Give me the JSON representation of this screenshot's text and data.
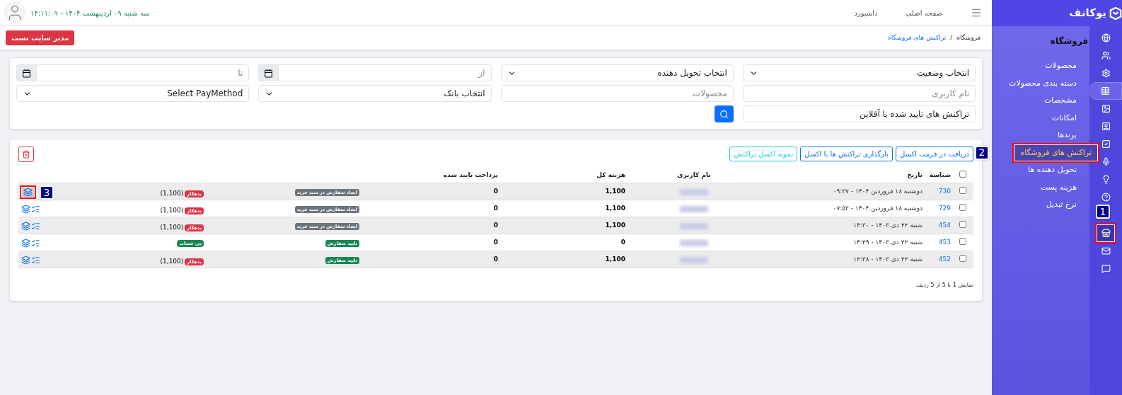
{
  "sidebar": {
    "logo": "یوکانف",
    "icons": [
      {
        "selected": false
      },
      {
        "selected": false
      },
      {
        "selected": false
      },
      {
        "selected": true
      },
      {
        "selected": false
      },
      {
        "selected": false
      },
      {
        "selected": false
      },
      {
        "selected": false
      },
      {
        "selected": false
      },
      {
        "selected": false
      },
      {
        "selected": false,
        "callout": "1"
      },
      {
        "selected": false
      },
      {
        "selected": false
      }
    ],
    "section": "فروشگاه",
    "items": [
      {
        "label": "محصولات",
        "selected": false
      },
      {
        "label": "دسته بندی محصولات",
        "selected": false
      },
      {
        "label": "مشخصات",
        "selected": false
      },
      {
        "label": "امکانات",
        "selected": false
      },
      {
        "label": "برندها",
        "selected": false
      },
      {
        "label": "تراکنش های فروشگاه",
        "selected": true,
        "callout": "2"
      },
      {
        "label": "تحویل دهنده ها",
        "selected": false
      },
      {
        "label": "هزینه پست",
        "selected": false
      },
      {
        "label": "نرخ تبدیل",
        "selected": false
      }
    ]
  },
  "header": {
    "nav": [
      "صفحه اصلی",
      "داشبورد"
    ],
    "datetime": "سه شنبه ۰۹ اردیبهشت ۱۴۰۴ - ۱۴:۱۱:۰۹"
  },
  "breadcrumb": [
    "فروشگاه",
    "/",
    "تراکنش های فروشگاه"
  ],
  "user_button": "مدیر سایت تست",
  "filters": [
    {
      "kind": "select",
      "value": "انتخاب وضعیت"
    },
    {
      "kind": "select",
      "value": "انتخاب تحویل دهنده"
    },
    {
      "kind": "date",
      "placeholder": "از"
    },
    {
      "kind": "date",
      "placeholder": "تا"
    },
    {
      "kind": "text",
      "placeholder": "نام کاربری"
    },
    {
      "kind": "text",
      "placeholder": "محصولات"
    },
    {
      "kind": "select",
      "value": "انتخاب بانک"
    },
    {
      "kind": "select",
      "value": "Select PayMethod"
    },
    {
      "kind": "text",
      "value": "تراکنش های تایید شده یا آفلاین"
    },
    {
      "kind": "search"
    }
  ],
  "actions": [
    {
      "label": "دریافت در فرمت اکسل",
      "kind": "primary"
    },
    {
      "label": "بارگذاری تراکنش ها با اکسل",
      "kind": "primary"
    },
    {
      "label": "نمونه اکسل تراکنش",
      "kind": "info"
    }
  ],
  "table": {
    "all_checked": false,
    "columns": [
      "شناسه",
      "تاریخ",
      "نام کاربری",
      "هزینه کل",
      "پرداخت تایید شده"
    ],
    "rows": [
      {
        "checked": false,
        "id": "730",
        "date": "دوشنبه ۱۸ فروردین ۱۴۰۴ - ۰۹:۳۷",
        "total": "1,100",
        "paid": "0",
        "status": {
          "label": "ایجاد سفارش در سبد خرید",
          "color": "#6c757d"
        },
        "balance": {
          "label": "بدهکار",
          "color": "#dc3545"
        },
        "amount": "(1,100)",
        "callout": "3"
      },
      {
        "checked": false,
        "id": "729",
        "date": "دوشنبه ۱۸ فروردین ۱۴۰۴ - ۰۷:۵۳",
        "total": "1,100",
        "paid": "0",
        "status": {
          "label": "ایجاد سفارش در سبد خرید",
          "color": "#6c757d"
        },
        "balance": {
          "label": "بدهکار",
          "color": "#dc3545"
        },
        "amount": "(1,100)"
      },
      {
        "checked": false,
        "id": "454",
        "date": "شنبه ۲۲ دی ۱۴۰۳ - ۱۴:۳۰",
        "total": "1,100",
        "paid": "0",
        "status": {
          "label": "ایجاد سفارش در سبد خرید",
          "color": "#6c757d"
        },
        "balance": {
          "label": "بدهکار",
          "color": "#dc3545"
        },
        "amount": "(1,100)"
      },
      {
        "checked": false,
        "id": "453",
        "date": "شنبه ۲۲ دی ۱۴۰۳ - ۱۴:۲۹",
        "total": "0",
        "paid": "0",
        "status": {
          "label": "تایید سفارش",
          "color": "#198754"
        },
        "balance": {
          "label": "بی حساب",
          "color": "#198754"
        }
      },
      {
        "checked": false,
        "id": "452",
        "date": "شنبه ۲۲ دی ۱۴۰۳ - ۱۲:۳۸",
        "total": "1,100",
        "paid": "0",
        "status": {
          "label": "تایید سفارش",
          "color": "#198754"
        },
        "balance": {
          "label": "بدهکار",
          "color": "#dc3545"
        },
        "amount": "(1,100)"
      }
    ]
  },
  "footer": "نمایش 1 تا 5 از 5 ردیف"
}
